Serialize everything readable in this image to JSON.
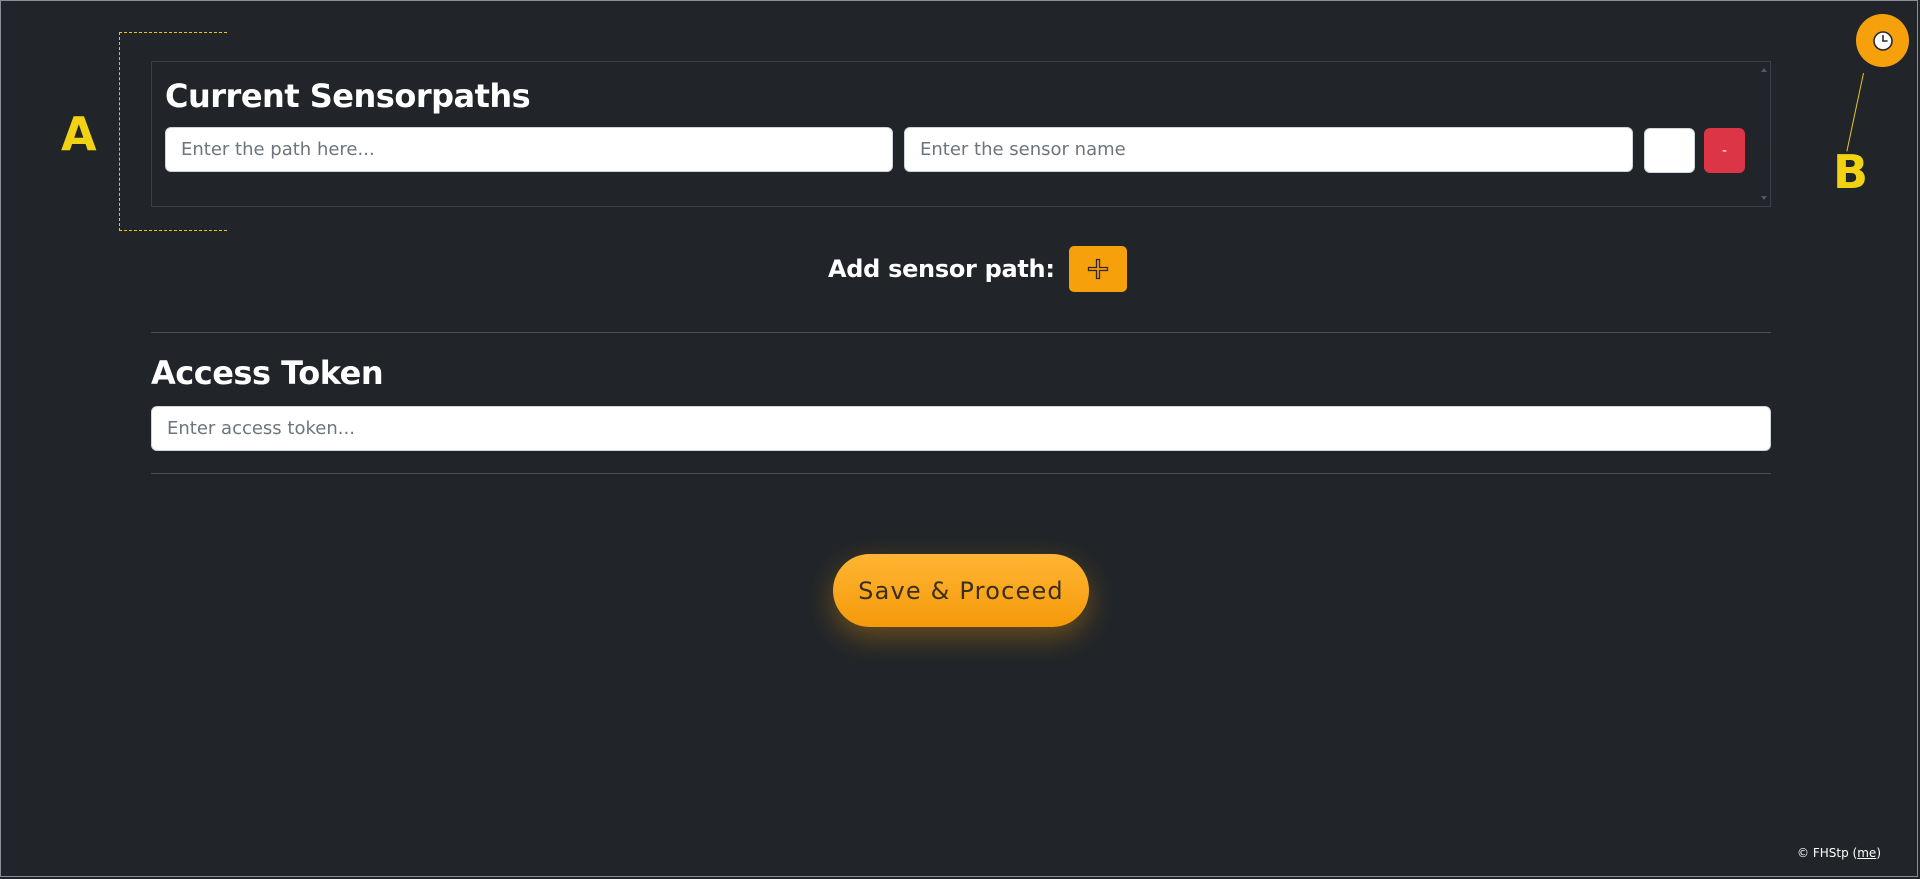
{
  "annotations": {
    "a_label": "A",
    "b_label": "B",
    "color": "#f2d313"
  },
  "clock_button": {
    "icon": "clock-icon",
    "color": "#f6a10c"
  },
  "sensorpaths": {
    "title": "Current Sensorpaths",
    "rows": [
      {
        "path_placeholder": "Enter the path here...",
        "name_placeholder": "Enter the sensor name",
        "remove_label": "-"
      }
    ]
  },
  "add_sensor": {
    "label": "Add sensor path:",
    "icon": "plus-icon"
  },
  "access_token": {
    "title": "Access Token",
    "placeholder": "Enter access token..."
  },
  "save_button": {
    "label": "Save & Proceed"
  },
  "footer": {
    "prefix": "© FHStp (",
    "link": "me",
    "suffix": ")"
  },
  "colors": {
    "background": "#212529",
    "accent": "#f6a10c",
    "danger": "#dc3545"
  }
}
